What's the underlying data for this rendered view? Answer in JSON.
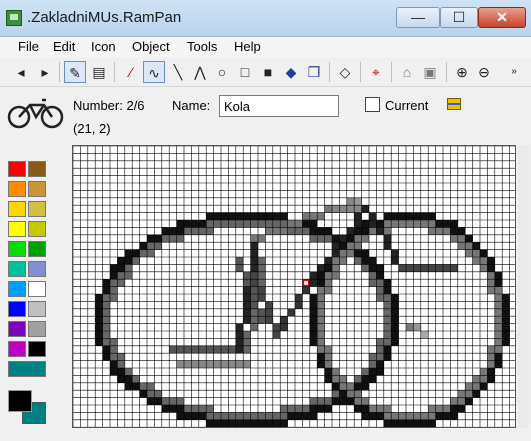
{
  "window": {
    "title": ".ZakladniMUs.RamPan"
  },
  "titlebar": {
    "min_glyph": "—",
    "max_glyph": "☐",
    "close_glyph": "✕"
  },
  "menu": {
    "items": [
      "File",
      "Edit",
      "Icon",
      "Object",
      "Tools",
      "Help"
    ]
  },
  "toolbar": {
    "tools": [
      {
        "name": "prev-icon",
        "glyph": "◂"
      },
      {
        "name": "next-icon",
        "glyph": "▸"
      },
      {
        "name": "pencil-icon",
        "glyph": "✎",
        "active": true
      },
      {
        "name": "hatch-icon",
        "glyph": "▤"
      },
      {
        "name": "picker-icon",
        "glyph": "⁄"
      },
      {
        "name": "freehand-icon",
        "glyph": "∿",
        "active": true
      },
      {
        "name": "line-icon",
        "glyph": "╲"
      },
      {
        "name": "polyline-icon",
        "glyph": "⋀"
      },
      {
        "name": "ellipse-icon",
        "glyph": "○"
      },
      {
        "name": "rectangle-icon",
        "glyph": "□"
      },
      {
        "name": "filled-rect-icon",
        "glyph": "■"
      },
      {
        "name": "fill-icon",
        "glyph": "◆"
      },
      {
        "name": "copy-icon",
        "glyph": "❐"
      },
      {
        "name": "eraser-icon",
        "glyph": "◇"
      },
      {
        "name": "origin-icon",
        "glyph": "⌖"
      },
      {
        "name": "home-icon",
        "glyph": "⌂"
      },
      {
        "name": "frame-icon",
        "glyph": "▣"
      },
      {
        "name": "zoom-in-icon",
        "glyph": "⊕"
      },
      {
        "name": "zoom-out-icon",
        "glyph": "⊖"
      }
    ]
  },
  "info": {
    "number_label": "Number: 2/6",
    "name_label": "Name:",
    "name_value": "Kola",
    "current_label": "Current",
    "coords": "(21, 2)"
  },
  "palette": {
    "colors": [
      "#ff0000",
      "#8b5a14",
      "#ff8c00",
      "#c89632",
      "#ffd700",
      "#d4c040",
      "#ffff00",
      "#c8c800",
      "#00e000",
      "#00a000",
      "#00c0a0",
      "#8090d0",
      "#00a0ff",
      "#ffffff",
      "#0000ff",
      "#c0c0c0",
      "#8000c0",
      "#a0a0a0",
      "#c000c0",
      "#000000"
    ],
    "wide_color": "#008080",
    "foreground": "#000000",
    "background": "#008080"
  },
  "canvas": {
    "grid_line_color": "#000000"
  }
}
